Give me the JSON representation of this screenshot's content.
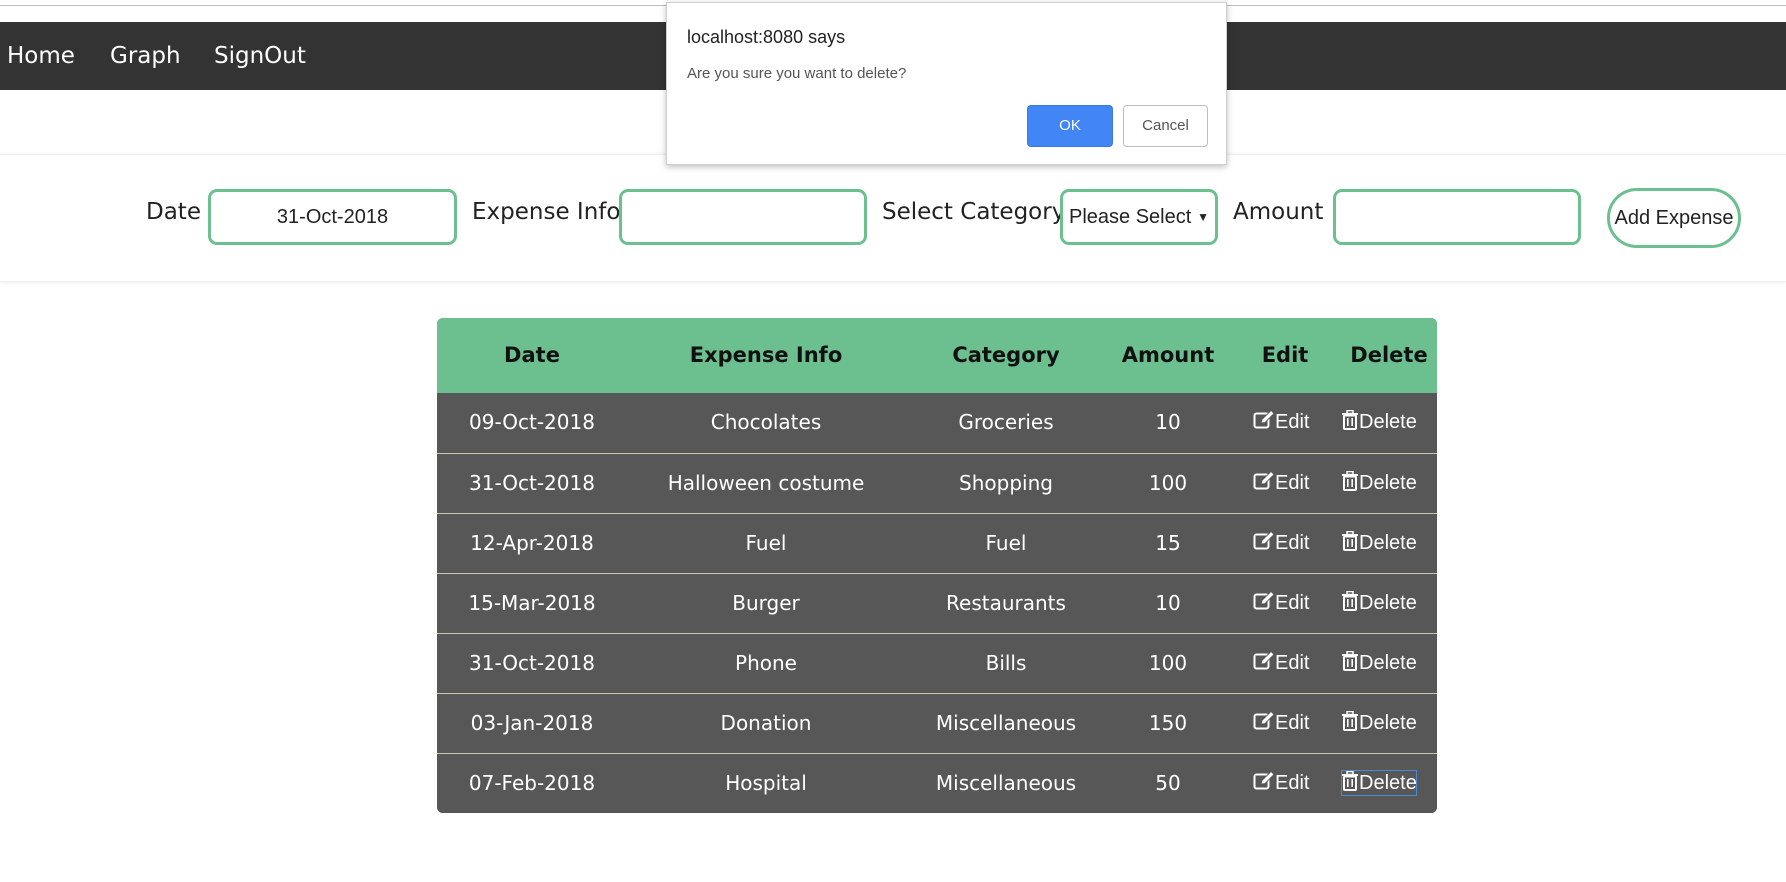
{
  "nav": {
    "items": [
      {
        "label": "Home"
      },
      {
        "label": "Graph"
      },
      {
        "label": "SignOut"
      }
    ]
  },
  "form": {
    "date_label": "Date",
    "date_value": "31-Oct-2018",
    "info_label": "Expense Info",
    "info_value": "",
    "category_label": "Select Category",
    "category_selected": "Please Select",
    "amount_label": "Amount",
    "amount_value": "",
    "add_button": "Add Expense"
  },
  "table": {
    "headers": [
      "Date",
      "Expense Info",
      "Category",
      "Amount",
      "Edit",
      "Delete"
    ],
    "rows": [
      {
        "date": "09-Oct-2018",
        "info": "Chocolates",
        "category": "Groceries",
        "amount": "10"
      },
      {
        "date": "31-Oct-2018",
        "info": "Halloween costume",
        "category": "Shopping",
        "amount": "100"
      },
      {
        "date": "12-Apr-2018",
        "info": "Fuel",
        "category": "Fuel",
        "amount": "15"
      },
      {
        "date": "15-Mar-2018",
        "info": "Burger",
        "category": "Restaurants",
        "amount": "10"
      },
      {
        "date": "31-Oct-2018",
        "info": "Phone",
        "category": "Bills",
        "amount": "100"
      },
      {
        "date": "03-Jan-2018",
        "info": "Donation",
        "category": "Miscellaneous",
        "amount": "150"
      },
      {
        "date": "07-Feb-2018",
        "info": "Hospital",
        "category": "Miscellaneous",
        "amount": "50"
      }
    ],
    "edit_label": "Edit",
    "delete_label": "Delete",
    "edit_icon": "edit-icon",
    "delete_icon": "trash-icon"
  },
  "dialog": {
    "title": "localhost:8080 says",
    "message": "Are you sure you want to delete?",
    "ok": "OK",
    "cancel": "Cancel"
  },
  "colors": {
    "navbar": "#333333",
    "accent": "#6cbf8f",
    "table_row": "#575757",
    "ok_button": "#4285f4"
  }
}
